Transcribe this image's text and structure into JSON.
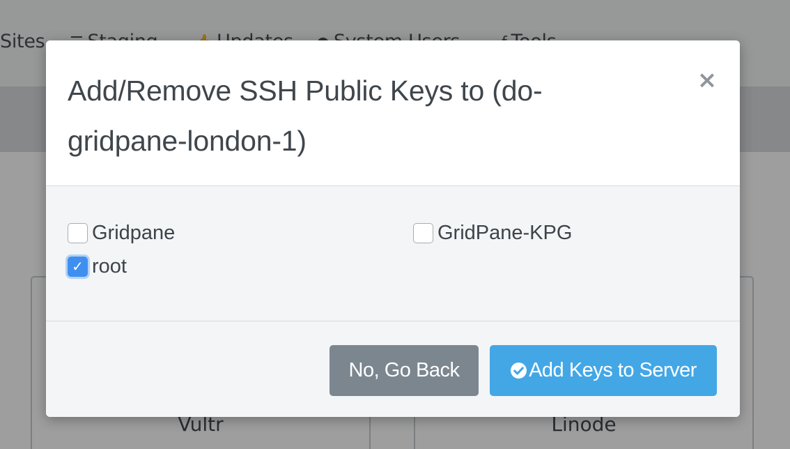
{
  "background": {
    "nav_items": [
      {
        "label": "Sites",
        "icon": "none"
      },
      {
        "label": "Staging",
        "icon": "sliders-icon"
      },
      {
        "label": "Updates",
        "icon": "thumbs-up-icon"
      },
      {
        "label": "System Users",
        "icon": "user-icon"
      },
      {
        "label": "Tools",
        "icon": "wrench-icon"
      }
    ],
    "cards": [
      {
        "label": "Vultr"
      },
      {
        "label": "Linode"
      }
    ]
  },
  "modal": {
    "title": "Add/Remove SSH Public Keys to (do-gridpane-london-1)",
    "close_label": "×",
    "keys": [
      {
        "label": "Gridpane",
        "checked": false
      },
      {
        "label": "GridPane-KPG",
        "checked": false
      },
      {
        "label": "root",
        "checked": true
      }
    ],
    "buttons": {
      "back_label": "No, Go Back",
      "add_label": "Add Keys to Server"
    },
    "colors": {
      "primary": "#43a7e6",
      "secondary": "#7c868f",
      "checkbox_checked": "#3f8ff1"
    }
  }
}
